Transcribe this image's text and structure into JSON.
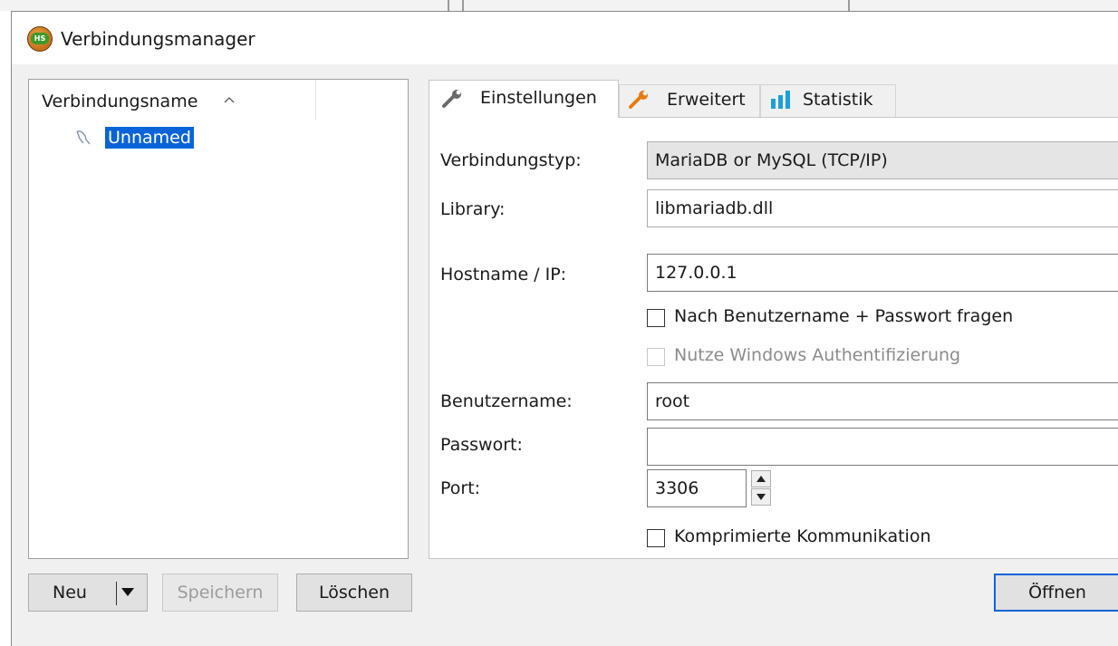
{
  "window": {
    "title": "Verbindungsmanager",
    "icon": "heidisql-icon"
  },
  "sessions": {
    "header": "Verbindungsname",
    "items": [
      {
        "label": "Unnamed",
        "selected": true,
        "icon": "dolphin-icon"
      }
    ]
  },
  "tabs": [
    {
      "label": "Einstellungen",
      "icon": "wrench-icon",
      "active": true
    },
    {
      "label": "Erweitert",
      "icon": "wrench-icon",
      "active": false
    },
    {
      "label": "Statistik",
      "icon": "bar-chart-icon",
      "active": false
    }
  ],
  "settings": {
    "type_label": "Verbindungstyp:",
    "type_value": "MariaDB or MySQL (TCP/IP)",
    "library_label": "Library:",
    "library_value": "libmariadb.dll",
    "host_label": "Hostname / IP:",
    "host_value": "127.0.0.1",
    "prompt_label": "Nach Benutzername + Passwort fragen",
    "windows_auth_label": "Nutze Windows Authentifizierung",
    "user_label": "Benutzername:",
    "user_value": "root",
    "password_label": "Passwort:",
    "password_value": "",
    "port_label": "Port:",
    "port_value": "3306",
    "compress_label": "Komprimierte Kommunikation"
  },
  "buttons": {
    "new": "Neu",
    "save": "Speichern",
    "delete": "Löschen",
    "open": "Öffnen"
  },
  "colors": {
    "selection": "#0a64d8",
    "wrench": "#e87a12",
    "chart": "#1ca0d8"
  }
}
